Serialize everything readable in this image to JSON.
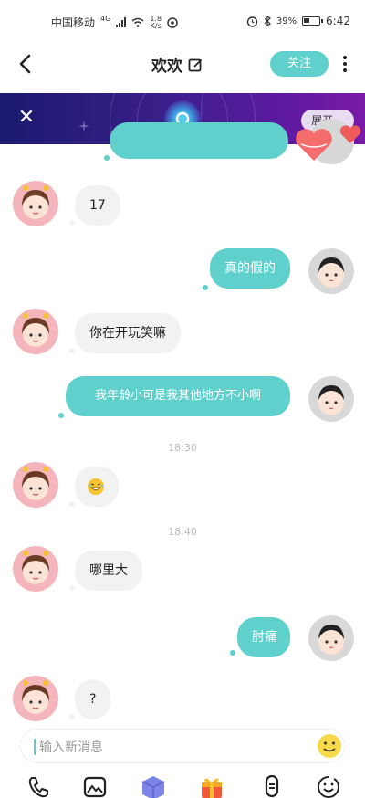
{
  "status_bar": {
    "carrier": "中国移动",
    "network_type": "4G",
    "speed_value": "1.8",
    "speed_unit": "K/s",
    "battery_percent": "39%",
    "time": "6:42"
  },
  "header": {
    "back_icon": "chevron-left-icon",
    "title": "欢欢",
    "follow_label": "关注"
  },
  "banner": {
    "expand_label": "展开"
  },
  "messages": [
    {
      "side": "in",
      "text": "17"
    },
    {
      "side": "out",
      "text": "真的假的"
    },
    {
      "side": "in",
      "text": "你在开玩笑嘛"
    },
    {
      "side": "out",
      "text": "我年龄小可是我其他地方不小啊"
    },
    {
      "type": "time",
      "text": "18:30"
    },
    {
      "side": "in",
      "text": "😂"
    },
    {
      "type": "time",
      "text": "18:40"
    },
    {
      "side": "in",
      "text": "哪里大"
    },
    {
      "side": "out",
      "text": "肘痛"
    },
    {
      "side": "in",
      "text": "?"
    }
  ],
  "input": {
    "placeholder": "输入新消息"
  },
  "toolbar": {
    "items": [
      "phone-icon",
      "image-icon",
      "soul-box-icon",
      "gift-icon",
      "voice-icon",
      "emoji-face-icon"
    ]
  },
  "colors": {
    "accent": "#5fd0cc",
    "banner_start": "#1a1a6e",
    "banner_end": "#7a1aa8",
    "incoming_bubble": "#f2f2f2"
  }
}
